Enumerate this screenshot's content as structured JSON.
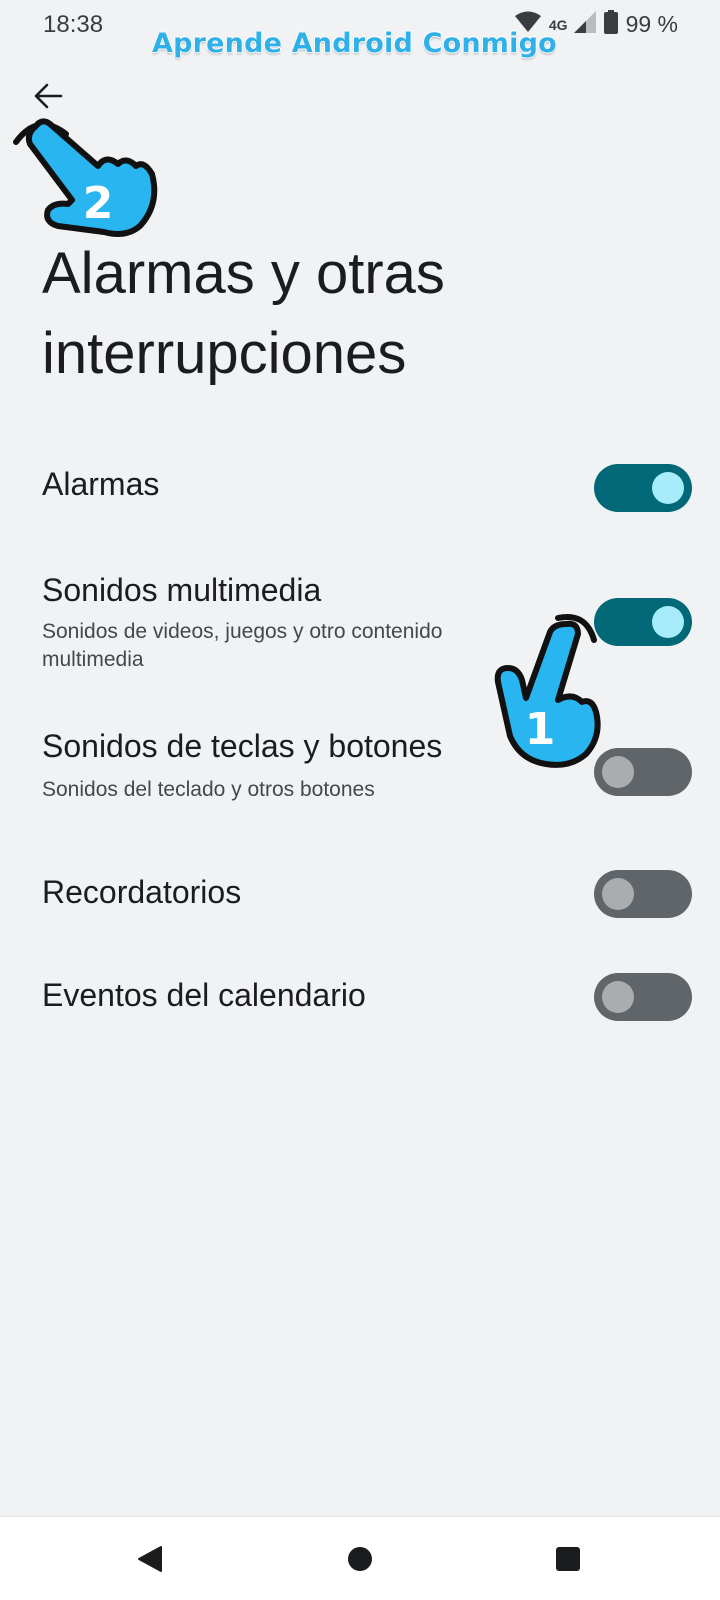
{
  "status": {
    "time": "18:38",
    "network": "4G",
    "battery": "99 %"
  },
  "watermark": "Aprende Android Conmigo",
  "page": {
    "title": "Alarmas y otras interrupciones"
  },
  "preferences": [
    {
      "title": "Alarmas",
      "summary": "",
      "checked": true
    },
    {
      "title": "Sonidos multimedia",
      "summary": "Sonidos de videos, juegos y otro contenido multimedia",
      "checked": true
    },
    {
      "title": "Sonidos de teclas y botones",
      "summary": "Sonidos del teclado y otros botones",
      "checked": false
    },
    {
      "title": "Recordatorios",
      "summary": "",
      "checked": false
    },
    {
      "title": "Eventos del calendario",
      "summary": "",
      "checked": false
    }
  ],
  "annotations": {
    "step1": "1",
    "step2": "2"
  },
  "icons": {
    "back": "arrow-back-icon",
    "wifi": "wifi-icon",
    "signal": "signal-icon",
    "battery": "battery-icon",
    "hand": "tap-hand-icon",
    "nav_back": "triangle-back-icon",
    "nav_home": "circle-home-icon",
    "nav_recents": "square-recents-icon"
  },
  "colors": {
    "background": "#f0f2f4",
    "switch_on_track": "#006876",
    "switch_on_thumb": "#a6ecfb",
    "switch_off_track": "#5f6568",
    "switch_off_thumb": "#a9adb0",
    "watermark": "#2fb0e8",
    "hand_fill": "#29b6f0"
  }
}
